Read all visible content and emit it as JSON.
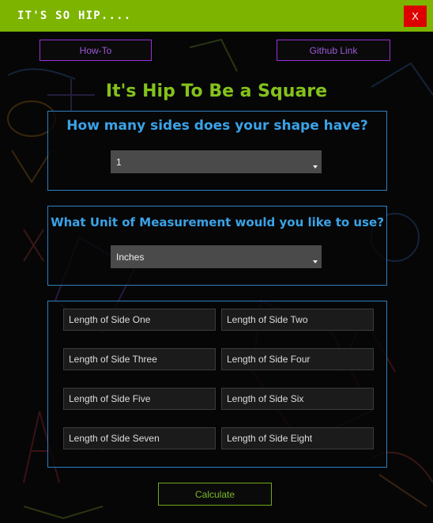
{
  "window": {
    "title": "IT'S SO HIP....",
    "close_label": "X"
  },
  "top_buttons": {
    "howto_label": "How-To",
    "github_label": "Github Link"
  },
  "heading": "It's Hip To Be a Square",
  "sides_section": {
    "question": "How many sides does your shape have?",
    "selected": "1"
  },
  "unit_section": {
    "question": "What Unit of Measurement would you like to use?",
    "selected": "Inches"
  },
  "side_fields": [
    {
      "placeholder": "Length of Side One"
    },
    {
      "placeholder": "Length of Side Two"
    },
    {
      "placeholder": "Length of Side Three"
    },
    {
      "placeholder": "Length of Side Four"
    },
    {
      "placeholder": "Length of Side Five"
    },
    {
      "placeholder": "Length of Side Six"
    },
    {
      "placeholder": "Length of Side Seven"
    },
    {
      "placeholder": "Length of Side Eight"
    }
  ],
  "calculate_label": "Calculate",
  "colors": {
    "titlebar": "#7cb400",
    "close": "#dd0000",
    "accent_purple": "#9b30d8",
    "heading_green": "#84c21c",
    "question_blue": "#3aa3e8",
    "panel_border": "#2e7fbf"
  }
}
